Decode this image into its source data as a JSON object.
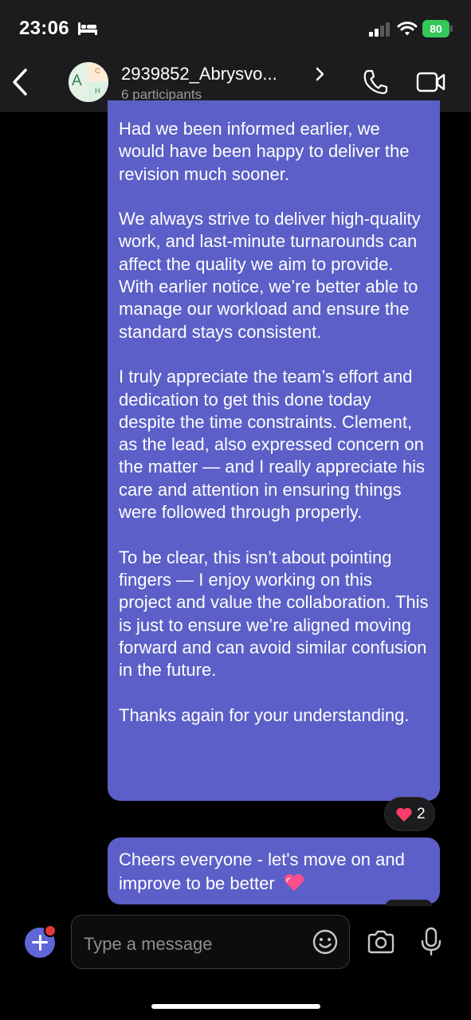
{
  "status_bar": {
    "time": "23:06",
    "battery_level": "80",
    "icons": [
      "bed-icon",
      "signal-icon",
      "wifi-icon",
      "battery-icon"
    ]
  },
  "header": {
    "title": "2939852_Abrysvo...",
    "subtitle": "6 participants",
    "avatar_letters": {
      "left": "A",
      "top_right": "C",
      "bottom_right": "H"
    },
    "icons": [
      "back-icon",
      "chevron-right-icon",
      "phone-icon",
      "video-icon"
    ]
  },
  "messages": [
    {
      "paragraphs": [
        "Had we been informed earlier, we would have been happy to deliver the revision much sooner.",
        "We always strive to deliver high-quality work, and last-minute turnarounds can affect the quality we aim to provide. With earlier notice, we’re better able to manage our workload and ensure the standard stays consistent.",
        "I truly appreciate the team’s effort and dedication to get this done today despite the time constraints. Clement, as the lead, also expressed concern on the matter — and I really appreciate his care and attention in ensuring things were followed through properly.",
        "To be clear, this isn’t about pointing fingers — I enjoy working on this project and value the collaboration. This is just to ensure we’re aligned moving forward and can avoid similar confusion in the future.",
        "Thanks again for your understanding."
      ],
      "reaction": {
        "icon": "heart-icon",
        "count": "2"
      }
    },
    {
      "text": "Cheers everyone - let's move on and improve to be better",
      "emoji": "heart-emoji-icon"
    }
  ],
  "compose": {
    "placeholder": "Type a message",
    "icons": [
      "plus-icon",
      "emoji-icon",
      "camera-icon",
      "microphone-icon"
    ]
  },
  "colors": {
    "bubble": "#5b5fc7",
    "accent": "#6065d8",
    "header_bg": "#1c1c1e",
    "battery": "#34c759",
    "heart": "#ff3b6b"
  }
}
